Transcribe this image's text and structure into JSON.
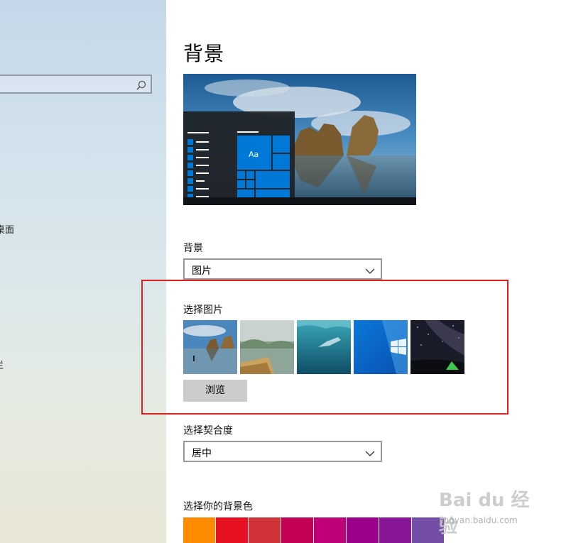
{
  "sidebar": {
    "item_desktop_fragment": "桌面",
    "item_fragment_2": "栏"
  },
  "page": {
    "title": "背景"
  },
  "background": {
    "label": "背景",
    "value": "图片"
  },
  "choose_picture": {
    "label": "选择图片",
    "thumbnails": [
      "seaside-arch",
      "rafts-lake",
      "underwater-swimmer",
      "windows-blue",
      "starry-tent"
    ],
    "browse_label": "浏览"
  },
  "fit": {
    "label": "选择契合度",
    "value": "居中"
  },
  "background_color": {
    "label": "选择你的背景色",
    "colors": [
      "#ff8c00",
      "#e81123",
      "#d13438",
      "#c30052",
      "#bf0077",
      "#9a0089",
      "#881798",
      "#744da9"
    ]
  },
  "preview": {
    "tile_text": "Aa"
  },
  "watermark": {
    "main": "Bai du 经验",
    "sub": "jingyan.baidu.com"
  },
  "colors": {
    "accent": "#0078d7",
    "highlight_box": "#e01e1e"
  }
}
